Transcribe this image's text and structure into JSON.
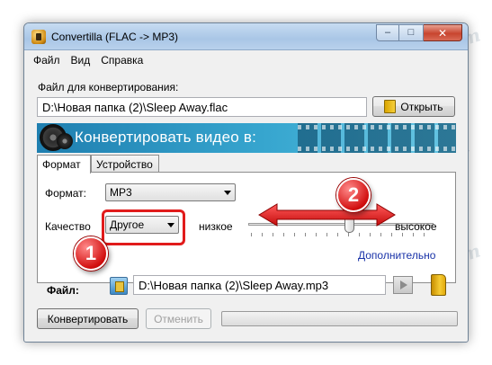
{
  "window": {
    "title": "Convertilla  (FLAC -> MP3)",
    "buttons": {
      "minimize": "–",
      "maximize": "□",
      "close": "✕"
    }
  },
  "menu": [
    "Файл",
    "Вид",
    "Справка"
  ],
  "source": {
    "label": "Файл для конвертирования:",
    "value": "D:\\Новая папка (2)\\Sleep Away.flac",
    "open_button": "Открыть"
  },
  "banner": {
    "text": "Конвертировать видео в:"
  },
  "tabs": [
    "Формат",
    "Устройство"
  ],
  "format": {
    "label": "Формат:",
    "value": "MP3",
    "quality_label": "Качество",
    "quality_value": "Другое",
    "low_label": "низкое",
    "high_label": "высокое",
    "advanced_link": "Дополнительно"
  },
  "output": {
    "label": "Файл:",
    "value": "D:\\Новая папка (2)\\Sleep Away.mp3"
  },
  "actions": {
    "convert": "Конвертировать",
    "cancel": "Отменить"
  },
  "annotations": {
    "badge_1": "1",
    "badge_2": "2"
  },
  "watermark": "Soringpcrepair.com",
  "colors": {
    "annotation": "#e11b1b",
    "link": "#1a33a8",
    "banner": "#2f98c6"
  },
  "icons": {
    "app": "convertilla-reel-icon",
    "open": "folder-icon",
    "play": "play-icon",
    "browse": "folder-icon"
  }
}
